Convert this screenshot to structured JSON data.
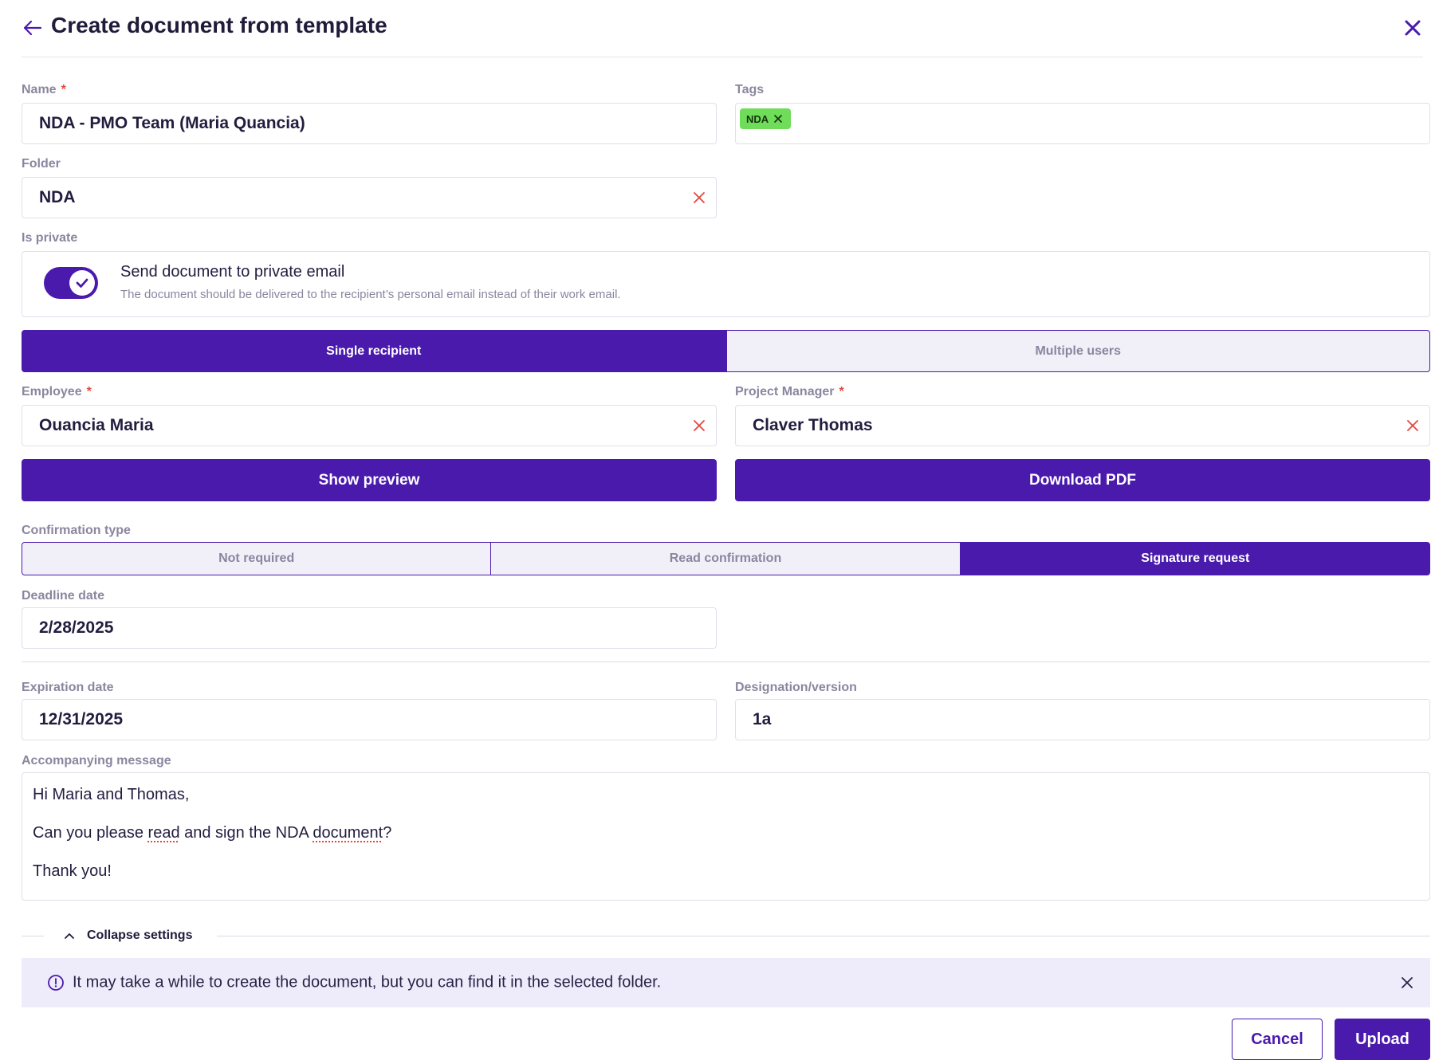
{
  "header": {
    "title": "Create document from template"
  },
  "name": {
    "label": "Name",
    "value": "NDA - PMO Team (Maria Quancia)"
  },
  "tags": {
    "label": "Tags",
    "items": [
      "NDA"
    ],
    "tag_color": "#6fdc5a"
  },
  "folder": {
    "label": "Folder",
    "value": "NDA"
  },
  "is_private": {
    "label": "Is private",
    "enabled": true,
    "title": "Send document to private email",
    "description": "The document should be delivered to the recipient’s personal email instead of their work email."
  },
  "recipient_mode": {
    "options": [
      "Single recipient",
      "Multiple users"
    ],
    "selected": "Single recipient"
  },
  "employee": {
    "label": "Employee",
    "value": "Ouancia Maria"
  },
  "project_manager": {
    "label": "Project Manager",
    "value": "Claver Thomas"
  },
  "actions": {
    "show_preview": "Show preview",
    "download_pdf": "Download PDF"
  },
  "confirmation": {
    "label": "Confirmation type",
    "options": [
      "Not required",
      "Read confirmation",
      "Signature request"
    ],
    "selected": "Signature request"
  },
  "deadline": {
    "label": "Deadline date",
    "value": "2/28/2025"
  },
  "expiration": {
    "label": "Expiration date",
    "value": "12/31/2025"
  },
  "designation": {
    "label": "Designation/version",
    "value": "1a"
  },
  "message": {
    "label": "Accompanying message",
    "line1": "Hi Maria and Thomas,",
    "line2_a": "Can you please ",
    "line2_b": "read",
    "line2_c": " and sign the NDA ",
    "line2_d": "document",
    "line2_e": "?",
    "line3": "Thank you!"
  },
  "collapse": {
    "label": "Collapse settings"
  },
  "banner": {
    "text": "It may take a while to create the document, but you can find it in the selected folder."
  },
  "footer": {
    "cancel": "Cancel",
    "upload": "Upload"
  },
  "colors": {
    "accent": "#4a1aad",
    "required": "#e2483d",
    "banner_bg": "#eeebfb"
  }
}
